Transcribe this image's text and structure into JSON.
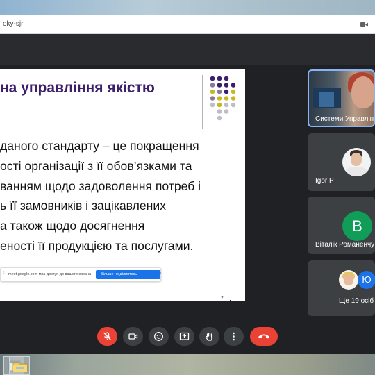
{
  "browser": {
    "address_fragment": "oky-sjr"
  },
  "slide": {
    "title": "на управління якістю",
    "body_lines": [
      "даного стандарту – це покращення",
      "ості організації з її обов’язками та",
      "ванням щодо задоволення потреб і",
      "ь її замовників і зацікавлених",
      "а також щодо досягнення",
      "еності її продукцією та послугами."
    ],
    "page_number": "2",
    "dot_colors": [
      "#3b1f6b",
      "#8a7a9a",
      "#c8b820",
      "#c0bcc8"
    ]
  },
  "notification": {
    "text": "meet.google.com має доступ до вашого екрана",
    "button_label": "Більше не діливтесь",
    "close_label": "Сховати"
  },
  "participants": [
    {
      "name": "Системи Управлін"
    },
    {
      "name": "Igor P"
    },
    {
      "name": "Віталік Романенчу",
      "avatar_letter": "B",
      "avatar_color": "#0f9d58"
    },
    {
      "name": "Ще 19 осіб",
      "extra_initial": "Ю"
    }
  ],
  "controls": [
    {
      "name": "microphone",
      "icon": "mic-off-icon",
      "state": "off"
    },
    {
      "name": "camera",
      "icon": "camera-icon"
    },
    {
      "name": "reactions",
      "icon": "emoji-icon"
    },
    {
      "name": "present",
      "icon": "present-icon"
    },
    {
      "name": "raise-hand",
      "icon": "hand-icon"
    },
    {
      "name": "more-options",
      "icon": "more-vert-icon"
    },
    {
      "name": "leave-call",
      "icon": "end-call-icon"
    }
  ]
}
